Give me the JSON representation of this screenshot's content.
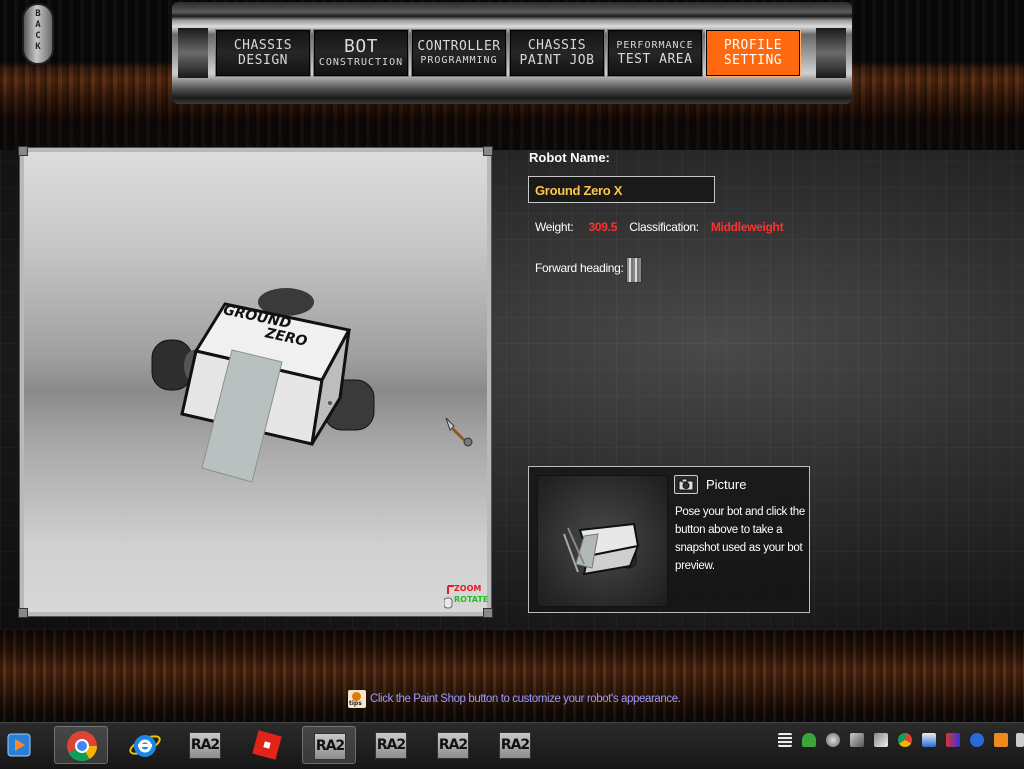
{
  "back_button": {
    "label": "BACK"
  },
  "nav_tabs": [
    {
      "id": "chassis-design",
      "line1": "CHASSIS",
      "line2": "DESIGN",
      "active": false
    },
    {
      "id": "bot-construction",
      "line1": "BOT",
      "line2": "CONSTRUCTION",
      "active": false
    },
    {
      "id": "controller-programming",
      "line1": "CONTROLLER",
      "line2": "PROGRAMMING",
      "active": false
    },
    {
      "id": "chassis-paint-job",
      "line1": "CHASSIS",
      "line2": "PAINT JOB",
      "active": false
    },
    {
      "id": "performance-test-area",
      "line1": "PERFORMANCE",
      "line2": "TEST AREA",
      "active": false
    },
    {
      "id": "profile-setting",
      "line1": "PROFILE",
      "line2": "SETTING",
      "active": true
    }
  ],
  "viewport": {
    "decal_line1": "GROUND",
    "decal_line2": "ZERO",
    "zoom_label": "ZOOM",
    "rotate_label": "ROTATE"
  },
  "profile": {
    "robot_name_label": "Robot Name:",
    "robot_name_value": "Ground Zero X",
    "weight_label": "Weight:",
    "weight_value": "309.5",
    "classification_label": "Classification:",
    "classification_value": "Middleweight",
    "forward_heading_label": "Forward heading:"
  },
  "picture_panel": {
    "title": "Picture",
    "description": "Pose your bot and click the button above to take a snapshot used as your bot preview."
  },
  "tip": {
    "icon_text": "tips",
    "text": "Click the Paint Shop button to customize your robot's appearance."
  },
  "taskbar": {
    "ra2_label": "RA2"
  },
  "colors": {
    "active_tab": "#ff6a10",
    "robot_name": "#ffc64a",
    "stat_value": "#ff3030",
    "tip_text": "#9a9aff"
  }
}
